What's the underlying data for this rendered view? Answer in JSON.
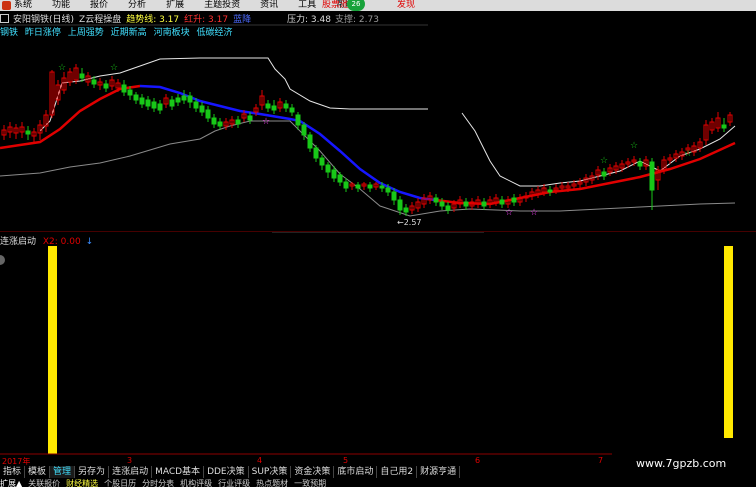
{
  "menu": {
    "items": [
      "系统",
      "功能",
      "报价",
      "分析",
      "扩展",
      "主题投资",
      "资讯",
      "工具",
      "帮助"
    ],
    "alert": "股票池",
    "badge": "26",
    "alert2": "发现"
  },
  "legend": {
    "stock": "安阳钢铁(日线)",
    "indicator": "Z云程操盘",
    "trend_label": "趋势线: 3.17",
    "red_label": "红升: 3.17",
    "blue_label": "蓝降",
    "pressure": "压力: 3.48",
    "support": "支撑: 2.73"
  },
  "tags": [
    "钢铁",
    "昨日涨停",
    "上周强势",
    "近期新高",
    "河南板块",
    "低碳经济"
  ],
  "annotations": {
    "low_price": "←2.57"
  },
  "sub_chart": {
    "title": "连涨启动",
    "value": "X2: 0.00",
    "arrow": "↓"
  },
  "time_axis": {
    "year": "2017年",
    "marks": [
      "3",
      "4",
      "5",
      "6",
      "7"
    ]
  },
  "tabs": [
    "指标",
    "模板",
    "管理",
    "另存为",
    "连涨启动",
    "MACD基本",
    "DDE决策",
    "SUP决策",
    "资金决策",
    "底市启动",
    "自己用2",
    "财源亨通"
  ],
  "bottom_row": [
    "扩展▲",
    "关联报价",
    "财经精选",
    "个股日历",
    "分时分表",
    "机构评级",
    "行业评级",
    "热点题材",
    "一致预期"
  ],
  "watermark": "www.7gpzb.com",
  "colors": {
    "up": "#e00000",
    "down": "#18c818",
    "trend_up": "#e00000",
    "trend_down": "#1616ff",
    "bar": "#ffe800"
  }
}
